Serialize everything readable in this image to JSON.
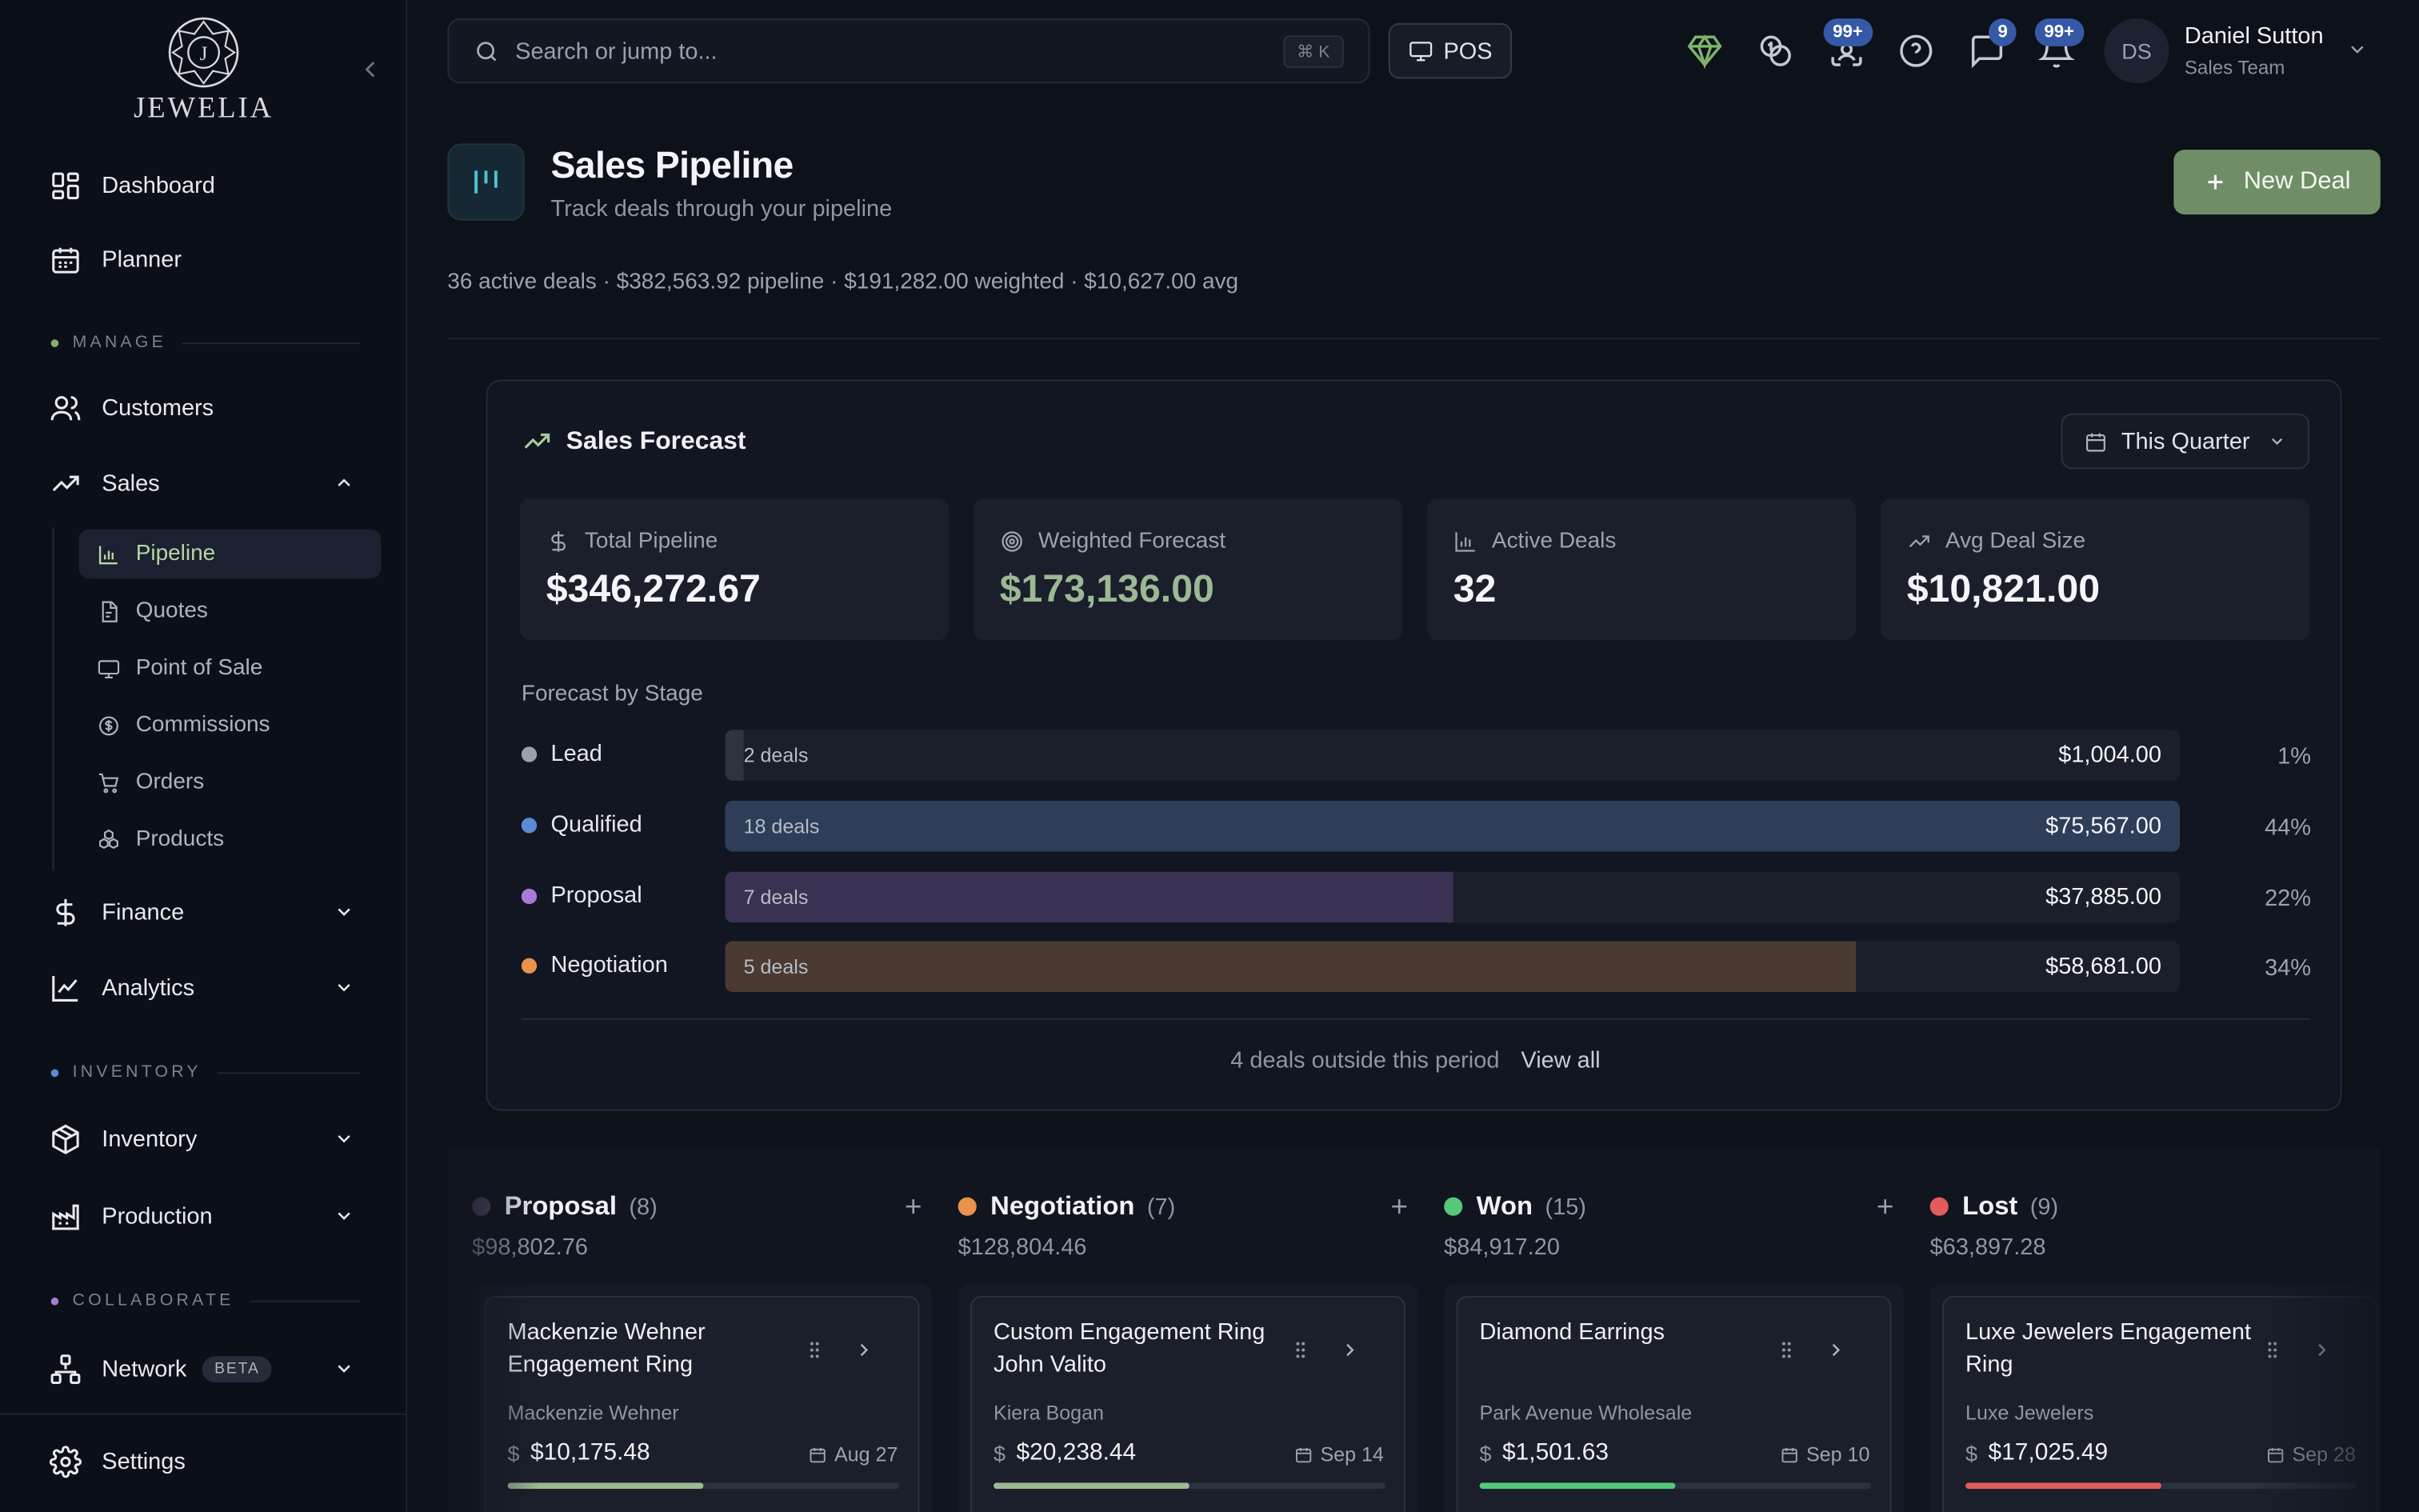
{
  "brand": {
    "name": "JEWELIA",
    "logo_letter": "J"
  },
  "sidebar": {
    "top_items": [
      {
        "label": "Dashboard",
        "icon": "dashboard-icon"
      },
      {
        "label": "Planner",
        "icon": "calendar-icon"
      }
    ],
    "sections": {
      "manage": {
        "label": "MANAGE",
        "color": "#7fb26a"
      },
      "inventory": {
        "label": "INVENTORY",
        "color": "#5b8bd6"
      },
      "collaborate": {
        "label": "COLLABORATE",
        "color": "#a77bd6"
      }
    },
    "manage_items": [
      {
        "label": "Customers",
        "icon": "users-icon"
      },
      {
        "label": "Sales",
        "icon": "trending-up-icon",
        "expanded": true
      }
    ],
    "sales_subitems": [
      {
        "label": "Pipeline",
        "icon": "bar-chart-icon",
        "active": true
      },
      {
        "label": "Quotes",
        "icon": "document-icon"
      },
      {
        "label": "Point of Sale",
        "icon": "monitor-icon"
      },
      {
        "label": "Commissions",
        "icon": "coin-icon"
      },
      {
        "label": "Orders",
        "icon": "cart-icon"
      },
      {
        "label": "Products",
        "icon": "boxes-icon"
      }
    ],
    "manage_items_after": [
      {
        "label": "Finance",
        "icon": "dollar-icon"
      },
      {
        "label": "Analytics",
        "icon": "line-chart-icon"
      }
    ],
    "inventory_items": [
      {
        "label": "Inventory",
        "icon": "package-icon"
      },
      {
        "label": "Production",
        "icon": "factory-icon"
      }
    ],
    "collaborate_items": [
      {
        "label": "Network",
        "icon": "network-icon",
        "badge": "BETA"
      }
    ],
    "settings": {
      "label": "Settings",
      "icon": "gear-icon"
    }
  },
  "topbar": {
    "search_placeholder": "Search or jump to...",
    "search_shortcut": "⌘ K",
    "pos_label": "POS",
    "badges": {
      "scan": "99+",
      "messages": "9",
      "notifications": "99+"
    },
    "user": {
      "initials": "DS",
      "name": "Daniel Sutton",
      "role": "Sales Team"
    }
  },
  "page": {
    "title": "Sales Pipeline",
    "subtitle": "Track deals through your pipeline",
    "new_deal_label": "New Deal",
    "summary": "36 active deals · $382,563.92 pipeline · $191,282.00 weighted · $10,627.00 avg"
  },
  "forecast": {
    "title": "Sales Forecast",
    "period": "This Quarter",
    "stats": [
      {
        "label": "Total Pipeline",
        "value": "$346,272.67",
        "icon": "dollar-icon"
      },
      {
        "label": "Weighted Forecast",
        "value": "$173,136.00",
        "icon": "target-icon",
        "accent": "#9cb894"
      },
      {
        "label": "Active Deals",
        "value": "32",
        "icon": "bar-chart-icon"
      },
      {
        "label": "Avg Deal Size",
        "value": "$10,821.00",
        "icon": "trending-up-icon"
      }
    ],
    "by_stage_label": "Forecast by Stage",
    "stages": [
      {
        "name": "Lead",
        "deals": "2 deals",
        "amount": "$1,004.00",
        "pct": "1%",
        "fill": 0.013,
        "dot": "#9aa0ad",
        "bar": "#2d3340"
      },
      {
        "name": "Qualified",
        "deals": "18 deals",
        "amount": "$75,567.00",
        "pct": "44%",
        "fill": 1.0,
        "dot": "#5b8bd6",
        "bar": "#2e3d58"
      },
      {
        "name": "Proposal",
        "deals": "7 deals",
        "amount": "$37,885.00",
        "pct": "22%",
        "fill": 0.501,
        "dot": "#a77bd6",
        "bar": "#3b3152"
      },
      {
        "name": "Negotiation",
        "deals": "5 deals",
        "amount": "$58,681.00",
        "pct": "34%",
        "fill": 0.777,
        "dot": "#e8924a",
        "bar": "#4a3a31"
      }
    ],
    "outside_text": "4 deals outside this period",
    "view_all": "View all"
  },
  "board": {
    "columns": [
      {
        "name": "Proposal",
        "count": "(8)",
        "total": "$98,802.76",
        "dot": "#4a4560",
        "card": {
          "title": "Mackenzie Wehner Engagement Ring",
          "company": "Mackenzie Wehner",
          "amount": "$10,175.48",
          "date": "Aug 27",
          "progress": 0.5,
          "progress_color": "#9cb894"
        }
      },
      {
        "name": "Negotiation",
        "count": "(7)",
        "total": "$128,804.46",
        "dot": "#e8924a",
        "card": {
          "title": "Custom Engagement Ring John Valito",
          "company": "Kiera Bogan",
          "amount": "$20,238.44",
          "date": "Sep 14",
          "progress": 0.5,
          "progress_color": "#9cb894"
        }
      },
      {
        "name": "Won",
        "count": "(15)",
        "total": "$84,917.20",
        "dot": "#55c87a",
        "card": {
          "title": "Diamond Earrings",
          "company": "Park Avenue Wholesale",
          "amount": "$1,501.63",
          "date": "Sep 10",
          "progress": 0.5,
          "progress_color": "#55c87a"
        }
      },
      {
        "name": "Lost",
        "count": "(9)",
        "total": "$63,897.28",
        "dot": "#e25c5c",
        "card": {
          "title": "Luxe Jewelers Engagement Ring",
          "company": "Luxe Jewelers",
          "amount": "$17,025.49",
          "date": "Sep 28",
          "progress": 0.5,
          "progress_color": "#e25c5c"
        }
      }
    ]
  }
}
